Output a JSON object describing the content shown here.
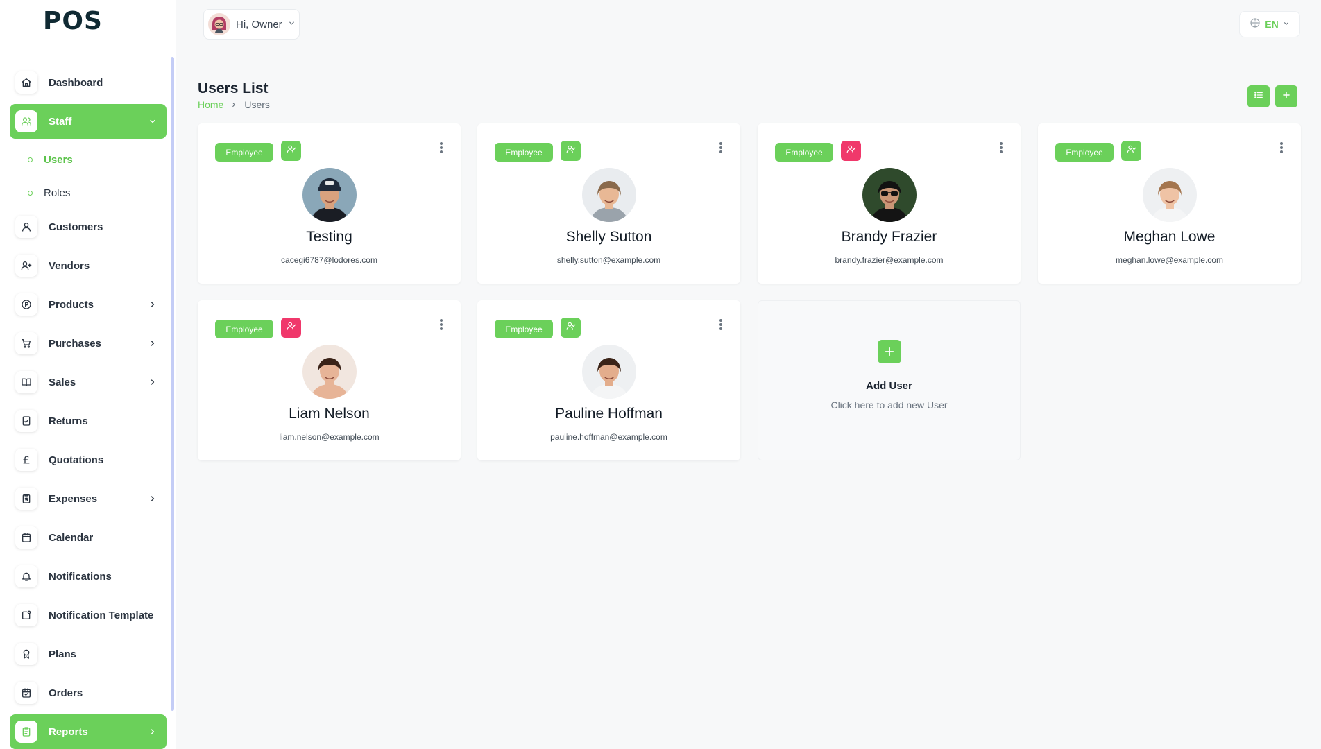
{
  "app": {
    "logo": "POS"
  },
  "header": {
    "greeting": "Hi, Owner",
    "language": "EN"
  },
  "sidebar": {
    "items": [
      {
        "key": "dashboard",
        "label": "Dashboard",
        "icon": "home-icon"
      },
      {
        "key": "staff",
        "label": "Staff",
        "icon": "users-icon",
        "active": true,
        "expanded": true
      },
      {
        "key": "customers",
        "label": "Customers",
        "icon": "user-icon"
      },
      {
        "key": "vendors",
        "label": "Vendors",
        "icon": "user-plus-icon"
      },
      {
        "key": "products",
        "label": "Products",
        "icon": "tag-circle-icon",
        "submenu": true
      },
      {
        "key": "purchases",
        "label": "Purchases",
        "icon": "cart-icon",
        "submenu": true
      },
      {
        "key": "sales",
        "label": "Sales",
        "icon": "book-icon",
        "submenu": true
      },
      {
        "key": "returns",
        "label": "Returns",
        "icon": "receipt-icon"
      },
      {
        "key": "quotations",
        "label": "Quotations",
        "icon": "pound-icon"
      },
      {
        "key": "expenses",
        "label": "Expenses",
        "icon": "clipboard-dollar-icon",
        "submenu": true
      },
      {
        "key": "calendar",
        "label": "Calendar",
        "icon": "calendar-icon"
      },
      {
        "key": "notifications",
        "label": "Notifications",
        "icon": "bell-icon"
      },
      {
        "key": "notification-template",
        "label": "Notification Template",
        "icon": "template-icon"
      },
      {
        "key": "plans",
        "label": "Plans",
        "icon": "award-icon"
      },
      {
        "key": "orders",
        "label": "Orders",
        "icon": "calendar-check-icon"
      },
      {
        "key": "reports",
        "label": "Reports",
        "icon": "report-icon",
        "active": true,
        "submenu": true
      }
    ],
    "staff_sub": [
      {
        "label": "Users",
        "active": true
      },
      {
        "label": "Roles"
      }
    ]
  },
  "page": {
    "title": "Users List",
    "breadcrumb": {
      "home": "Home",
      "current": "Users"
    }
  },
  "colors": {
    "accent": "#6bd05a",
    "danger": "#f0386b"
  },
  "users": [
    {
      "name": "Testing",
      "email": "cacegi6787@lodores.com",
      "badge": "Employee",
      "role_color": "green",
      "avatar": {
        "bg": "#8aa7b8",
        "skin": "#d9a27e",
        "hair": "#1d1f26",
        "shirt": "#1a1d24",
        "cap": true
      }
    },
    {
      "name": "Shelly Sutton",
      "email": "shelly.sutton@example.com",
      "badge": "Employee",
      "role_color": "green",
      "avatar": {
        "bg": "#e9ecef",
        "skin": "#e8b895",
        "hair": "#8a6a4c",
        "shirt": "#9aa3ab"
      }
    },
    {
      "name": "Brandy Frazier",
      "email": "brandy.frazier@example.com",
      "badge": "Employee",
      "role_color": "red",
      "avatar": {
        "bg": "#2f4a2c",
        "skin": "#c99676",
        "hair": "#121212",
        "shirt": "#141414",
        "glasses": true
      }
    },
    {
      "name": "Meghan Lowe",
      "email": "meghan.lowe@example.com",
      "badge": "Employee",
      "role_color": "green",
      "avatar": {
        "bg": "#eef0f2",
        "skin": "#efc3a5",
        "hair": "#a4764f",
        "shirt": "#f4f5f6"
      }
    },
    {
      "name": "Liam Nelson",
      "email": "liam.nelson@example.com",
      "badge": "Employee",
      "role_color": "red",
      "avatar": {
        "bg": "#f1e6df",
        "skin": "#e7b497",
        "hair": "#3a2217",
        "shirt": "#e7b497"
      }
    },
    {
      "name": "Pauline Hoffman",
      "email": "pauline.hoffman@example.com",
      "badge": "Employee",
      "role_color": "green",
      "avatar": {
        "bg": "#eef0f2",
        "skin": "#e3ad8c",
        "hair": "#3b2418",
        "shirt": "#f4f5f6"
      }
    }
  ],
  "add_card": {
    "title": "Add User",
    "subtitle": "Click here to add new User"
  }
}
